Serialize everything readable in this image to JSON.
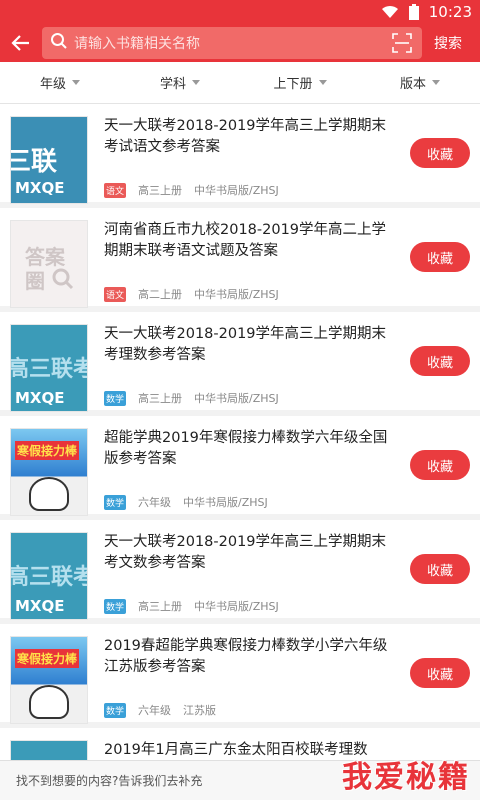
{
  "status": {
    "time": "10:23"
  },
  "search": {
    "placeholder": "请输入书籍相关名称",
    "button": "搜索"
  },
  "filters": [
    "年级",
    "学科",
    "上下册",
    "版本"
  ],
  "items": [
    {
      "title": "天一大联考2018-2019学年高三上学期期末考试语文参考答案",
      "subject": "语文",
      "grade": "高三上册",
      "publisher": "中华书局版/ZHSJ",
      "action": "收藏",
      "cover_text_top": "三联",
      "cover_text_bottom": "MXQE"
    },
    {
      "title": "河南省商丘市九校2018-2019学年高二上学期期末联考语文试题及答案",
      "subject": "语文",
      "grade": "高二上册",
      "publisher": "中华书局版/ZHSJ",
      "action": "收藏",
      "cover_text_top": "答案",
      "cover_text_bottom": "圈"
    },
    {
      "title": "天一大联考2018-2019学年高三上学期期末考理数参考答案",
      "subject": "数学",
      "grade": "高三上册",
      "publisher": "中华书局版/ZHSJ",
      "action": "收藏",
      "cover_text_top": "高三联考",
      "cover_text_bottom": "MXQE"
    },
    {
      "title": "超能学典2019年寒假接力棒数学六年级全国版参考答案",
      "subject": "数学",
      "grade": "六年级",
      "publisher": "中华书局版/ZHSJ",
      "action": "收藏",
      "cover_text_top": "寒假接力棒",
      "cover_text_bottom": ""
    },
    {
      "title": "天一大联考2018-2019学年高三上学期期末考文数参考答案",
      "subject": "数学",
      "grade": "高三上册",
      "publisher": "中华书局版/ZHSJ",
      "action": "收藏",
      "cover_text_top": "高三联考",
      "cover_text_bottom": "MXQE"
    },
    {
      "title": "2019春超能学典寒假接力棒数学小学六年级江苏版参考答案",
      "subject": "数学",
      "grade": "六年级",
      "publisher": "江苏版",
      "action": "收藏",
      "cover_text_top": "寒假接力棒",
      "cover_text_bottom": ""
    },
    {
      "title": "2019年1月高三广东金太阳百校联考理数",
      "subject": "",
      "grade": "",
      "publisher": "",
      "action": "",
      "cover_text_top": "",
      "cover_text_bottom": ""
    }
  ],
  "footer": {
    "text": "找不到想要的内容?告诉我们去补充",
    "watermark": "我爱秘籍"
  },
  "colors": {
    "primary": "#e8343a",
    "tag_red": "#ea5a58",
    "tag_blue": "#3aa0d8"
  }
}
